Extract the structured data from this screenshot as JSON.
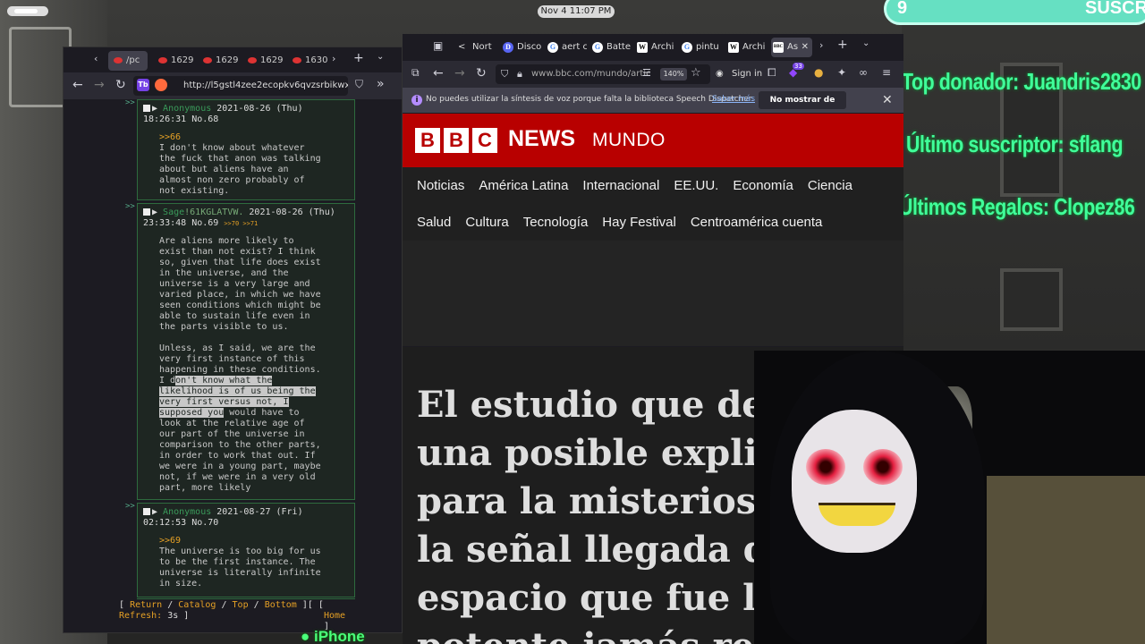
{
  "system": {
    "clock": "Nov 4  11:07 PM"
  },
  "overlay": {
    "sub_banner_left": "9",
    "sub_banner_right": "SUSCR",
    "top_donor": "Top donador: Juandris2830",
    "last_subscriber": "Último suscriptor: sflang",
    "last_gifts": "Últimos Regalos: Clopez86",
    "webcam_label": "iPhone"
  },
  "tor_browser": {
    "tabs": [
      {
        "label": "/pc"
      },
      {
        "label": "1629"
      },
      {
        "label": "1629"
      },
      {
        "label": "1629"
      },
      {
        "label": "1630"
      }
    ],
    "url": "http://l5gstl4zee2ecopkv6qvzsrbikwxnejp",
    "onion_badge": "Tb",
    "posts": [
      {
        "name": "Anonymous",
        "date": "2021-08-26 (Thu)",
        "time": "18:26:31",
        "no": "No.68",
        "backlinks": "",
        "quote": ">>66",
        "body": "I don't know about whatever\nthe fuck that anon was talking\nabout but aliens have an\nalmost non zero probably of\nnot existing."
      },
      {
        "name": "Sage",
        "trip": "!61KGLATVW.",
        "date": "2021-08-26 (Thu)",
        "time": "23:33:48",
        "no": "No.69",
        "backlinks": ">>70 >>71",
        "quote": "",
        "body_pre": "Are aliens more likely to\nexist than not exist? I think\nso, given that life does exist\nin the universe, and the\nuniverse is a very large and\nvaried place, in which we have\nseen conditions which might be\nable to sustain life even in\nthe parts visible to us.\n\nUnless, as I said, we are the\nvery first instance of this\nhappening in these conditions.\nI d",
        "body_hl": "on't know what the\nlikelihood is of us being the\nvery first versus not, I\nsupposed you",
        "body_post": " would have to\nlook at the relative age of\nour part of the universe in\ncomparison to the other parts,\nin order to work that out. If\nwe were in a young part, maybe\nnot, if we were in a very old\npart, more likely"
      },
      {
        "name": "Anonymous",
        "date": "2021-08-27 (Fri)",
        "time": "02:12:53",
        "no": "No.70",
        "backlinks": "",
        "quote": ">>69",
        "body": "The universe is too big for us\nto be the first instance. The\nuniverse is literally infinite\nin size."
      }
    ],
    "footer": {
      "open": "[",
      "return": "Return",
      "sep": "/",
      "catalog": "Catalog",
      "top": "Top",
      "bottom": "Bottom",
      "close": "][",
      "home_open": "[",
      "home": "Home",
      "home_close": "]",
      "refresh_label": "Refresh:",
      "refresh_value": "3s ]"
    }
  },
  "firefox": {
    "tabs": [
      {
        "label": "Nort",
        "icon": "<"
      },
      {
        "label": "Disco",
        "icon": "D"
      },
      {
        "label": "aert c",
        "icon": "G"
      },
      {
        "label": "Batte",
        "icon": "G"
      },
      {
        "label": "Archi",
        "icon": "W"
      },
      {
        "label": "pintu",
        "icon": "G"
      },
      {
        "label": "Archi",
        "icon": "W"
      },
      {
        "label": "As",
        "icon": "BBC"
      }
    ],
    "url": "www.bbc.com/mundo/artic",
    "zoom": "140%",
    "sign_in": "Sign in",
    "extension_badge": "33",
    "notification": {
      "message": "No puedes utilizar la síntesis de voz porque falta la biblioteca Speech Dispatcher.",
      "learn_more": "Saber más",
      "dismiss": "No mostrar de nuevo"
    },
    "bbc": {
      "blocks": [
        "B",
        "B",
        "C"
      ],
      "news": "NEWS",
      "mundo": "MUNDO",
      "nav_row1": [
        "Noticias",
        "América Latina",
        "Internacional",
        "EE.UU.",
        "Economía",
        "Ciencia"
      ],
      "nav_row2": [
        "Salud",
        "Cultura",
        "Tecnología",
        "Hay Festival",
        "Centroamérica cuenta"
      ],
      "headline": "El estudio que desc\nuna posible explica\npara la misteriosa W\nla señal llegada del\nespacio que fue la m\npotente jamás regis"
    }
  },
  "colors": {
    "bbc_red": "#b80000",
    "overlay_green": "#40ff9a",
    "chan_green": "#2e6b3e",
    "quote_orange": "#e5a025"
  }
}
